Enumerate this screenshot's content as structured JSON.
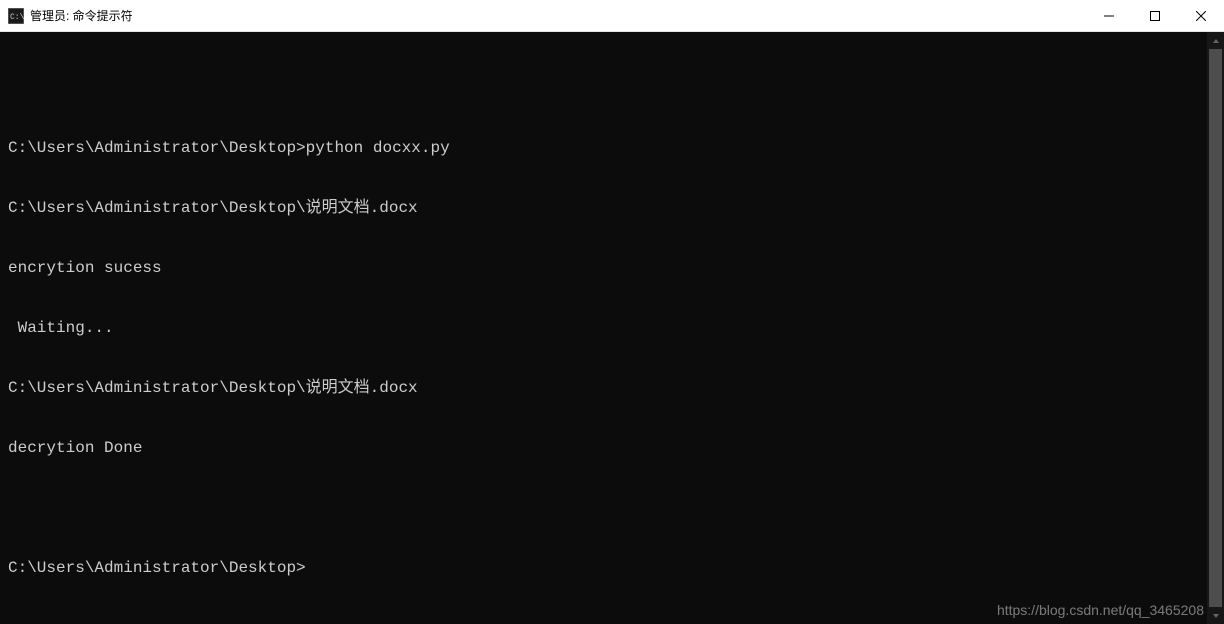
{
  "window": {
    "title": "管理员: 命令提示符"
  },
  "terminal": {
    "lines": [
      "",
      "C:\\Users\\Administrator\\Desktop>python docxx.py",
      "C:\\Users\\Administrator\\Desktop\\说明文档.docx",
      "encrytion sucess",
      " Waiting...",
      "C:\\Users\\Administrator\\Desktop\\说明文档.docx",
      "decrytion Done",
      "",
      "C:\\Users\\Administrator\\Desktop>"
    ]
  },
  "watermark": "https://blog.csdn.net/qq_3465208"
}
